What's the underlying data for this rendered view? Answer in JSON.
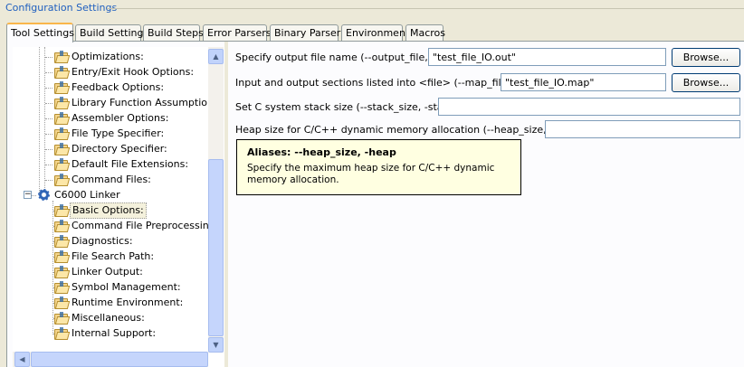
{
  "group": {
    "title": "Configuration Settings"
  },
  "tabs": [
    {
      "label": "Tool Settings",
      "active": true
    },
    {
      "label": "Build Settings"
    },
    {
      "label": "Build Steps"
    },
    {
      "label": "Error Parsers"
    },
    {
      "label": "Binary Parser"
    },
    {
      "label": "Environment"
    },
    {
      "label": "Macros"
    }
  ],
  "tree": {
    "items": [
      {
        "label": "Optimizations:",
        "icon": "folder-options-icon"
      },
      {
        "label": "Entry/Exit Hook Options:",
        "icon": "folder-options-icon"
      },
      {
        "label": "Feedback Options:",
        "icon": "folder-options-icon"
      },
      {
        "label": "Library Function Assumptions:",
        "icon": "folder-options-icon"
      },
      {
        "label": "Assembler Options:",
        "icon": "folder-options-icon"
      },
      {
        "label": "File Type Specifier:",
        "icon": "folder-options-icon"
      },
      {
        "label": "Directory Specifier:",
        "icon": "folder-options-icon"
      },
      {
        "label": "Default File Extensions:",
        "icon": "folder-options-icon"
      },
      {
        "label": "Command Files:",
        "icon": "folder-options-icon"
      }
    ],
    "linker": {
      "label": "C6000 Linker",
      "expander": "−",
      "icon": "gear-icon",
      "children": [
        {
          "label": "Basic Options:",
          "selected": true
        },
        {
          "label": "Command File Preprocessing:"
        },
        {
          "label": "Diagnostics:"
        },
        {
          "label": "File Search Path:"
        },
        {
          "label": "Linker Output:"
        },
        {
          "label": "Symbol Management:"
        },
        {
          "label": "Runtime Environment:"
        },
        {
          "label": "Miscellaneous:"
        },
        {
          "label": "Internal Support:"
        }
      ]
    },
    "scroll_up_glyph": "▲",
    "scroll_down_glyph": "▼",
    "scroll_left_glyph": "◀"
  },
  "form": {
    "output_file": {
      "label": "Specify output file name (--output_file, -o)",
      "value": "\"test_file_IO.out\"",
      "button": "Browse..."
    },
    "map_file": {
      "label": "Input and output sections listed into <file> (--map_file, -m)",
      "value": "\"test_file_IO.map\"",
      "button": "Browse..."
    },
    "stack_size": {
      "label": "Set C system stack size (--stack_size, -stack)",
      "value": ""
    },
    "heap_size": {
      "label": "Heap size for C/C++ dynamic memory allocation (--heap_size, -heap)",
      "value": ""
    }
  },
  "tooltip": {
    "title": "Aliases: --heap_size, -heap",
    "body": "Specify the maximum heap size for C/C++ dynamic memory allocation."
  },
  "colors": {
    "group_title": "#1F5FBF",
    "tooltip_bg": "#FFFFE1",
    "active_tab_accent": "#F9B64A"
  }
}
